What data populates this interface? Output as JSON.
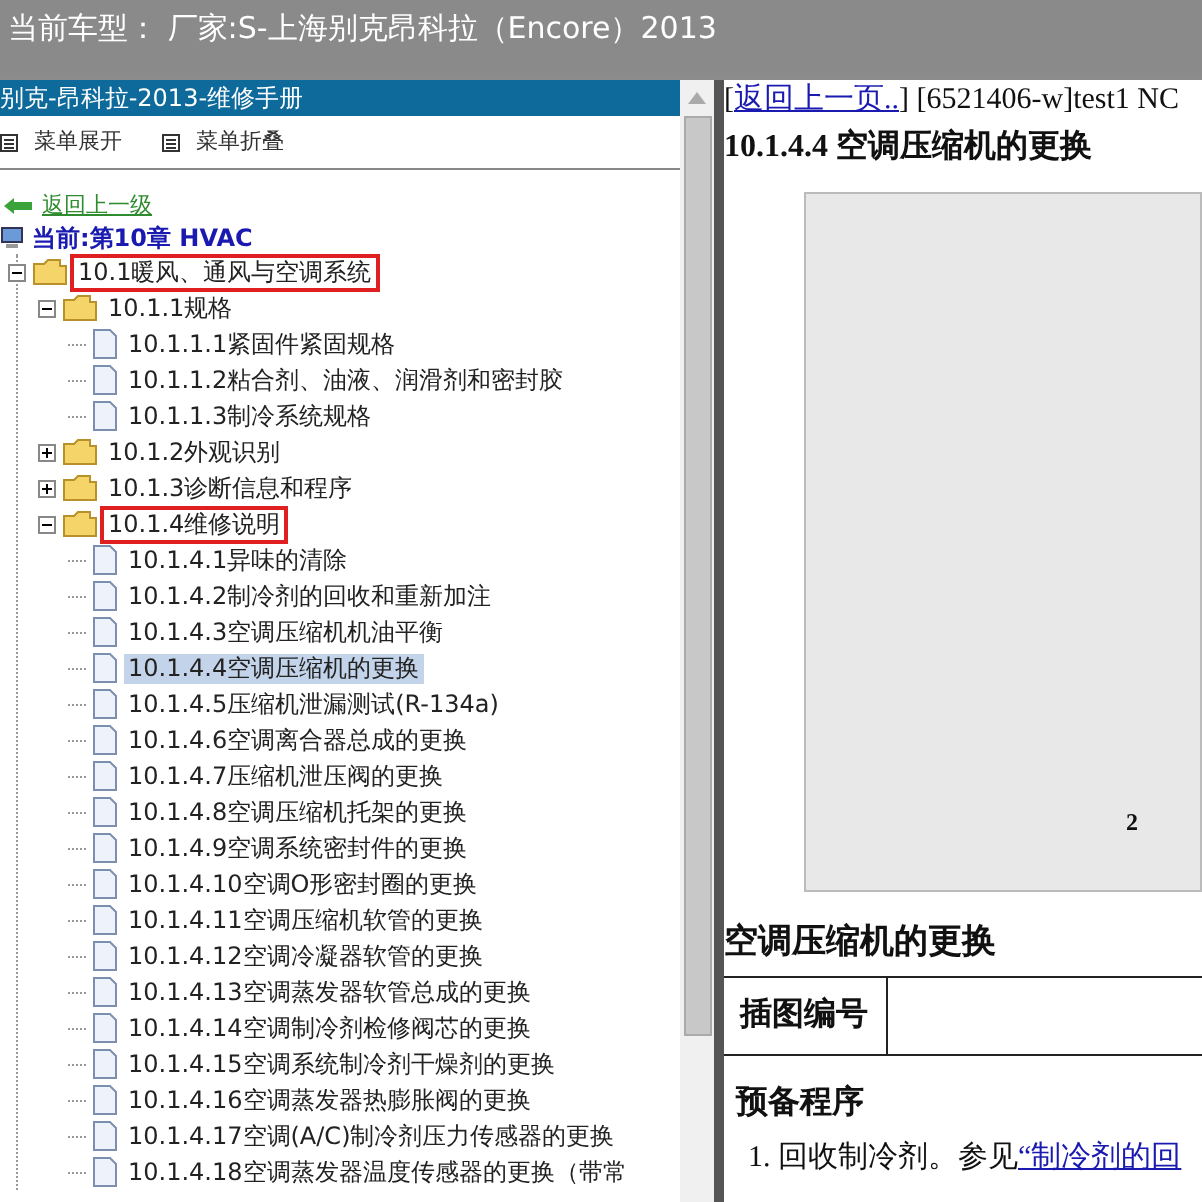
{
  "window": {
    "title": "当前车型： 厂家:S-上海别克昂科拉（Encore）2013"
  },
  "sidebar": {
    "title": "别克-昂科拉-2013-维修手册",
    "menu": [
      {
        "label": "菜单展开"
      },
      {
        "label": "菜单折叠"
      }
    ],
    "back_link": "返回上一级",
    "current": "当前:第10章 HVAC",
    "tree": [
      {
        "kind": "folder",
        "label": "10.1暖风、通风与空调系统",
        "expanded": true,
        "highlighted": true,
        "selected": false,
        "children": [
          {
            "kind": "folder",
            "label": "10.1.1规格",
            "expanded": true,
            "highlighted": false,
            "selected": false,
            "children": [
              {
                "kind": "page",
                "label": "10.1.1.1紧固件紧固规格",
                "selected": false,
                "highlighted": false
              },
              {
                "kind": "page",
                "label": "10.1.1.2粘合剂、油液、润滑剂和密封胶",
                "selected": false,
                "highlighted": false
              },
              {
                "kind": "page",
                "label": "10.1.1.3制冷系统规格",
                "selected": false,
                "highlighted": false
              }
            ]
          },
          {
            "kind": "folder",
            "label": "10.1.2外观识别",
            "expanded": false,
            "highlighted": false,
            "selected": false
          },
          {
            "kind": "folder",
            "label": "10.1.3诊断信息和程序",
            "expanded": false,
            "highlighted": false,
            "selected": false
          },
          {
            "kind": "folder",
            "label": "10.1.4维修说明",
            "expanded": true,
            "highlighted": true,
            "selected": false,
            "children": [
              {
                "kind": "page",
                "label": "10.1.4.1异味的清除",
                "selected": false,
                "highlighted": false
              },
              {
                "kind": "page",
                "label": "10.1.4.2制冷剂的回收和重新加注",
                "selected": false,
                "highlighted": false
              },
              {
                "kind": "page",
                "label": "10.1.4.3空调压缩机机油平衡",
                "selected": false,
                "highlighted": false
              },
              {
                "kind": "page",
                "label": "10.1.4.4空调压缩机的更换",
                "selected": true,
                "highlighted": false
              },
              {
                "kind": "page",
                "label": "10.1.4.5压缩机泄漏测试(R-134a)",
                "selected": false,
                "highlighted": false
              },
              {
                "kind": "page",
                "label": "10.1.4.6空调离合器总成的更换",
                "selected": false,
                "highlighted": false
              },
              {
                "kind": "page",
                "label": "10.1.4.7压缩机泄压阀的更换",
                "selected": false,
                "highlighted": false
              },
              {
                "kind": "page",
                "label": "10.1.4.8空调压缩机托架的更换",
                "selected": false,
                "highlighted": false
              },
              {
                "kind": "page",
                "label": "10.1.4.9空调系统密封件的更换",
                "selected": false,
                "highlighted": false
              },
              {
                "kind": "page",
                "label": "10.1.4.10空调O形密封圈的更换",
                "selected": false,
                "highlighted": false
              },
              {
                "kind": "page",
                "label": "10.1.4.11空调压缩机软管的更换",
                "selected": false,
                "highlighted": false
              },
              {
                "kind": "page",
                "label": "10.1.4.12空调冷凝器软管的更换",
                "selected": false,
                "highlighted": false
              },
              {
                "kind": "page",
                "label": "10.1.4.13空调蒸发器软管总成的更换",
                "selected": false,
                "highlighted": false
              },
              {
                "kind": "page",
                "label": "10.1.4.14空调制冷剂检修阀芯的更换",
                "selected": false,
                "highlighted": false
              },
              {
                "kind": "page",
                "label": "10.1.4.15空调系统制冷剂干燥剂的更换",
                "selected": false,
                "highlighted": false
              },
              {
                "kind": "page",
                "label": "10.1.4.16空调蒸发器热膨胀阀的更换",
                "selected": false,
                "highlighted": false
              },
              {
                "kind": "page",
                "label": "10.1.4.17空调(A/C)制冷剂压力传感器的更换",
                "selected": false,
                "highlighted": false
              },
              {
                "kind": "page",
                "label": "10.1.4.18空调蒸发器温度传感器的更换（带常",
                "selected": false,
                "highlighted": false
              }
            ]
          }
        ]
      }
    ]
  },
  "content": {
    "bracket_open": "[",
    "back_link": "返回上一页..",
    "doc_id": "] [6521406-w]test1 NC",
    "heading": "10.1.4.4 空调压缩机的更换",
    "figure_callout": "2",
    "section_title": "空调压缩机的更换",
    "table_label": "插图编号",
    "procedure_title": "预备程序",
    "step_text": "1. 回收制冷剂。参见",
    "step_link": "“制冷剂的回"
  }
}
